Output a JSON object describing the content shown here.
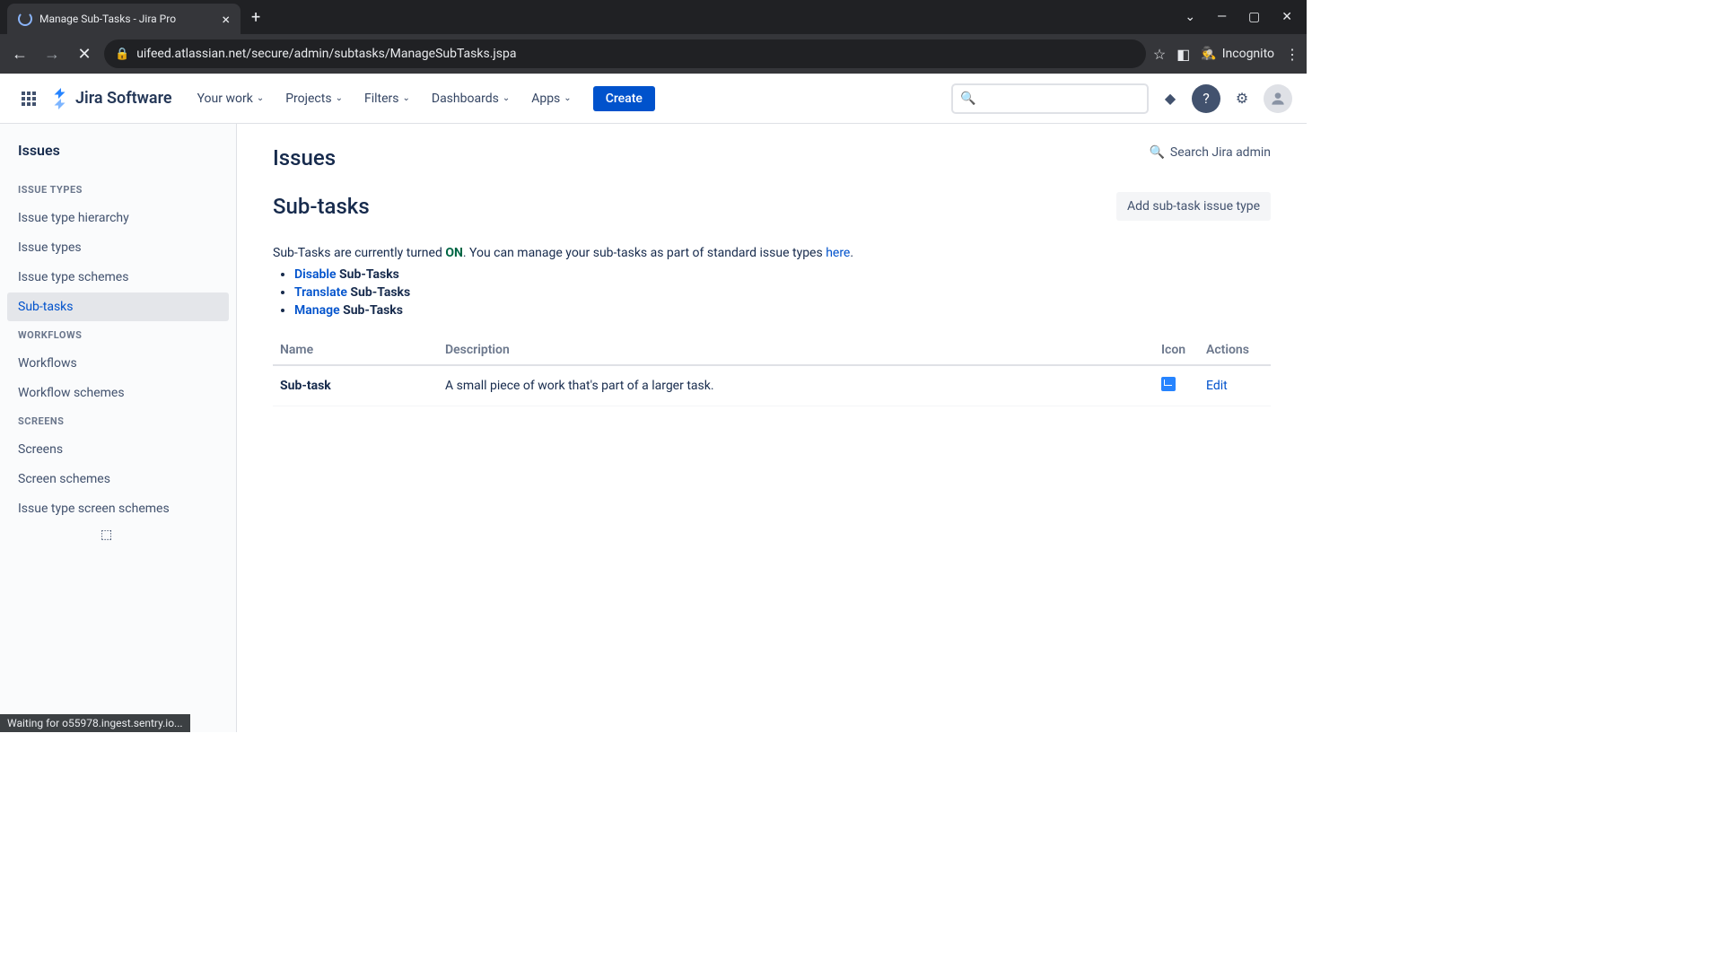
{
  "browser": {
    "tab_title": "Manage Sub-Tasks - Jira Pro",
    "url": "uifeed.atlassian.net/secure/admin/subtasks/ManageSubTasks.jspa",
    "incognito_label": "Incognito",
    "status_text": "Waiting for o55978.ingest.sentry.io..."
  },
  "header": {
    "logo_text": "Jira Software",
    "nav": [
      "Your work",
      "Projects",
      "Filters",
      "Dashboards",
      "Apps"
    ],
    "create_label": "Create"
  },
  "sidebar": {
    "title": "Issues",
    "sections": [
      {
        "label": "ISSUE TYPES",
        "items": [
          "Issue type hierarchy",
          "Issue types",
          "Issue type schemes",
          "Sub-tasks"
        ]
      },
      {
        "label": "WORKFLOWS",
        "items": [
          "Workflows",
          "Workflow schemes"
        ]
      },
      {
        "label": "SCREENS",
        "items": [
          "Screens",
          "Screen schemes",
          "Issue type screen schemes"
        ]
      }
    ],
    "active": "Sub-tasks"
  },
  "content": {
    "page_title": "Issues",
    "search_admin": "Search Jira admin",
    "sub_title": "Sub-tasks",
    "add_button": "Add sub-task issue type",
    "status_prefix": "Sub-Tasks are currently turned ",
    "status_value": "ON",
    "status_suffix": ". You can manage your sub-tasks as part of standard issue types ",
    "here_link": "here",
    "actions": [
      {
        "link": "Disable",
        "rest": " Sub-Tasks"
      },
      {
        "link": "Translate",
        "rest": " Sub-Tasks"
      },
      {
        "link": "Manage",
        "rest": " Sub-Tasks"
      }
    ],
    "table": {
      "headers": [
        "Name",
        "Description",
        "Icon",
        "Actions"
      ],
      "rows": [
        {
          "name": "Sub-task",
          "description": "A small piece of work that's part of a larger task.",
          "edit": "Edit"
        }
      ]
    }
  }
}
